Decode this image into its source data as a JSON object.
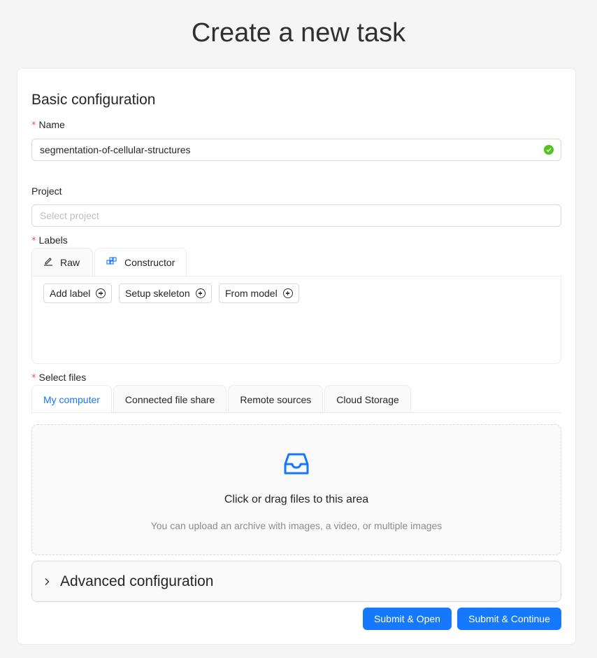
{
  "page": {
    "title": "Create a new task"
  },
  "basic": {
    "section_title": "Basic configuration",
    "name_label": "Name",
    "name_value": "segmentation-of-cellular-structures",
    "project_label": "Project",
    "project_placeholder": "Select project",
    "labels_label": "Labels",
    "labels_tabs": [
      {
        "label": "Raw",
        "icon": "edit-icon"
      },
      {
        "label": "Constructor",
        "icon": "blocks-icon"
      }
    ],
    "label_buttons": [
      "Add label",
      "Setup skeleton",
      "From model"
    ]
  },
  "files": {
    "label": "Select files",
    "tabs": [
      "My computer",
      "Connected file share",
      "Remote sources",
      "Cloud Storage"
    ],
    "dropzone_title": "Click or drag files to this area",
    "dropzone_hint": "You can upload an archive with images, a video, or multiple images",
    "icon": "inbox-icon"
  },
  "advanced": {
    "title": "Advanced configuration"
  },
  "actions": {
    "submit_open": "Submit & Open",
    "submit_continue": "Submit & Continue"
  },
  "colors": {
    "accent": "#1677ff",
    "success": "#52c41a",
    "required": "#ff4d4f"
  }
}
